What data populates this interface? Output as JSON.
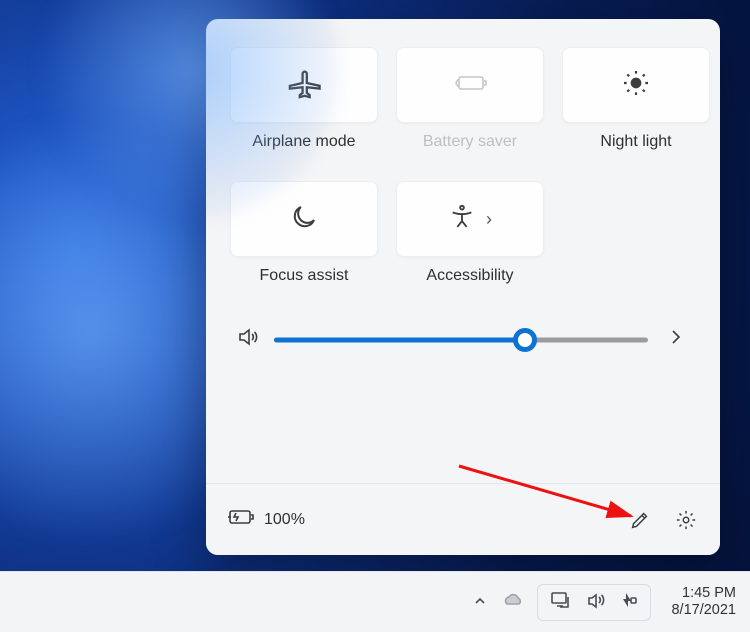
{
  "quick_settings": {
    "tiles": [
      {
        "id": "airplane",
        "label": "Airplane mode",
        "icon": "airplane-icon",
        "disabled": false,
        "has_expand": false
      },
      {
        "id": "battery-saver",
        "label": "Battery saver",
        "icon": "battery-saver-icon",
        "disabled": true,
        "has_expand": false
      },
      {
        "id": "night-light",
        "label": "Night light",
        "icon": "night-light-icon",
        "disabled": false,
        "has_expand": false
      },
      {
        "id": "focus-assist",
        "label": "Focus assist",
        "icon": "moon-icon",
        "disabled": false,
        "has_expand": false
      },
      {
        "id": "accessibility",
        "label": "Accessibility",
        "icon": "accessibility-icon",
        "disabled": false,
        "has_expand": true
      }
    ],
    "volume": {
      "percent": 67
    },
    "battery": {
      "text": "100%",
      "charging": true
    }
  },
  "taskbar": {
    "time": "1:45 PM",
    "date": "8/17/2021"
  }
}
